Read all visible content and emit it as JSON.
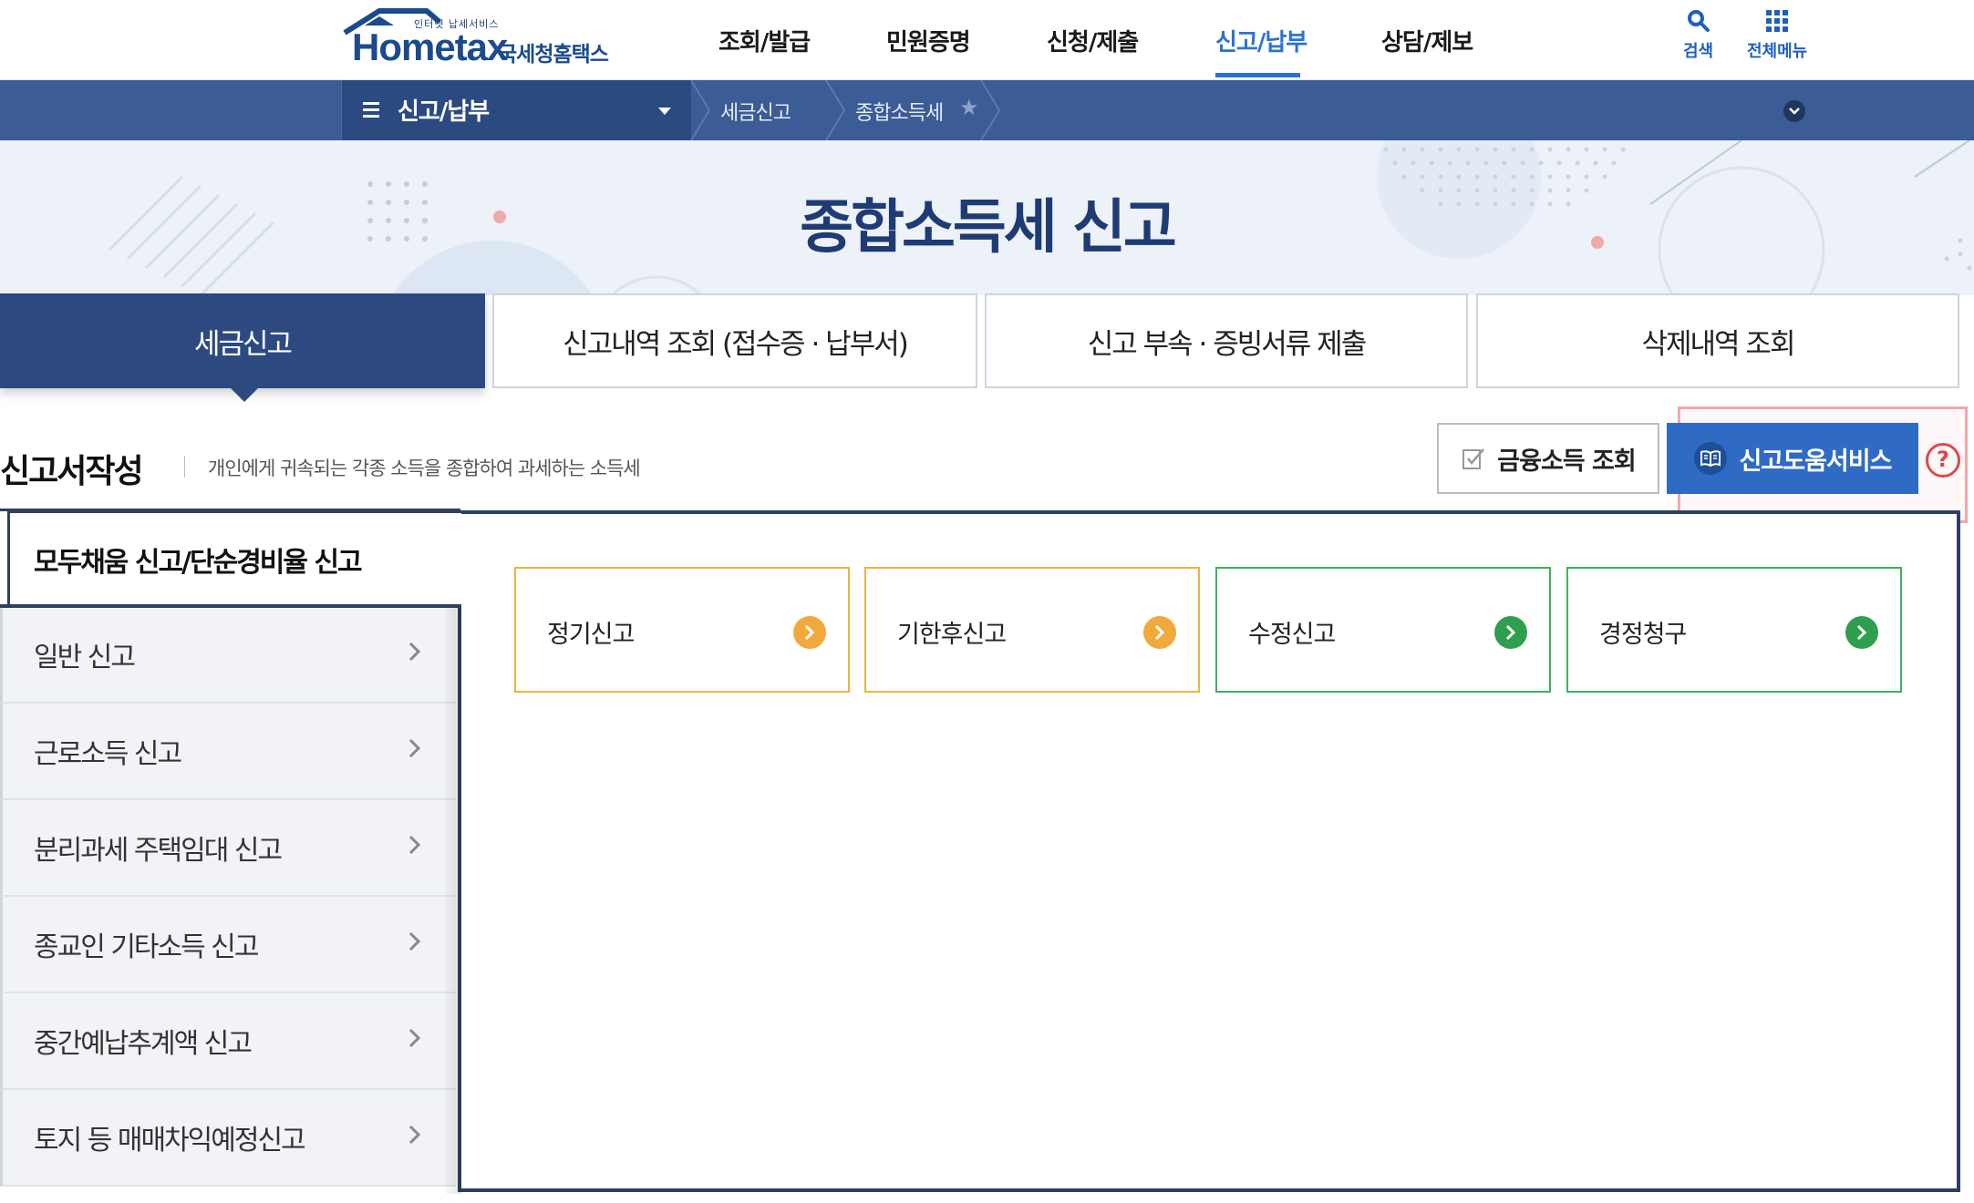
{
  "header": {
    "logo": {
      "tagline": "인터넷 납세서비스",
      "brand": "Hometax",
      "brand_sub": "국세청홈택스"
    },
    "nav": [
      {
        "label": "조회/발급",
        "active": false
      },
      {
        "label": "민원증명",
        "active": false
      },
      {
        "label": "신청/제출",
        "active": false
      },
      {
        "label": "신고/납부",
        "active": true
      },
      {
        "label": "상담/제보",
        "active": false
      }
    ],
    "utility": {
      "search_label": "검색",
      "all_menu_label": "전체메뉴"
    },
    "accent_color": "#2b72d4"
  },
  "breadcrumb_bar": {
    "menu_title": "신고/납부",
    "crumbs": [
      "세금신고",
      "종합소득세"
    ],
    "bar_color": "#3b5c95"
  },
  "hero": {
    "title": "종합소득세 신고"
  },
  "tabs": [
    {
      "label": "세금신고",
      "active": true
    },
    {
      "label": "신고내역 조회 (접수증 · 납부서)",
      "active": false
    },
    {
      "label": "신고 부속 · 증빙서류 제출",
      "active": false
    },
    {
      "label": "삭제내역 조회",
      "active": false
    }
  ],
  "section": {
    "title": "신고서작성",
    "description": "개인에게 귀속되는 각종 소득을 종합하여 과세하는 소득세",
    "financial_income_button": "금융소득 조회",
    "help_service_button": "신고도움서비스",
    "help_icon": "?"
  },
  "left_menu": {
    "active_item": "모두채움 신고/단순경비율 신고",
    "items": [
      "일반 신고",
      "근로소득 신고",
      "분리과세 주택임대 신고",
      "종교인 기타소득 신고",
      "중간예납추계액 신고",
      "토지 등 매매차익예정신고"
    ]
  },
  "filing_cards": [
    {
      "label": "정기신고",
      "color": "#f2a93b"
    },
    {
      "label": "기한후신고",
      "color": "#f2a93b"
    },
    {
      "label": "수정신고",
      "color": "#2f9e4e"
    },
    {
      "label": "경정청구",
      "color": "#2f9e4e"
    }
  ]
}
